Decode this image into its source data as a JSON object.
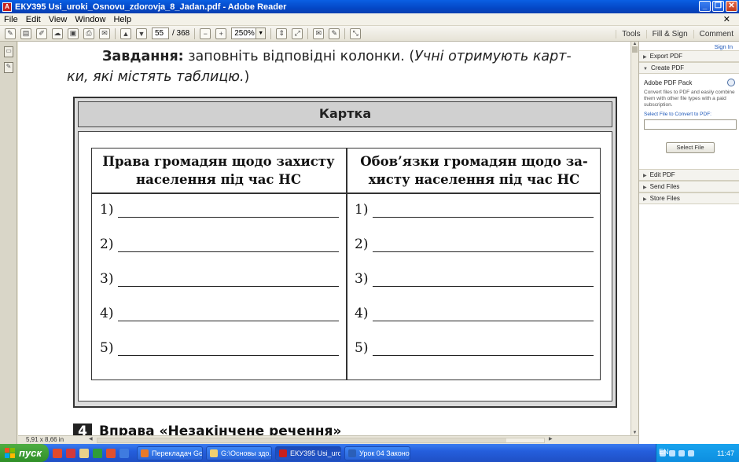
{
  "window": {
    "title": "ЕКУ395 Usi_uroki_Osnovu_zdorovja_8_Jadan.pdf - Adobe Reader"
  },
  "menu": {
    "items": [
      "File",
      "Edit",
      "View",
      "Window",
      "Help"
    ]
  },
  "toolbar": {
    "page_current": "55",
    "page_total": "/ 368",
    "zoom": "250%",
    "right_links": [
      "Tools",
      "Fill & Sign",
      "Comment"
    ]
  },
  "document": {
    "task_bold": "Завдання:",
    "task_text": " заповніть відповідні колонки. (",
    "task_italic": "Учні отримують карт-",
    "task2_italic": "ки, які містять таблицю.",
    "task2_end": ")",
    "card_title": "Картка",
    "col_left_header": "Права громадян щодо захисту населення під час НС",
    "col_right_header": "Обов’язки громадян щодо за- хисту населення під час НС",
    "rows": [
      "1)",
      "2)",
      "3)",
      "4)",
      "5)"
    ],
    "next_number": "4",
    "next_title": "Вправа «Незакінчене речення»"
  },
  "right_pane": {
    "sign_in": "Sign In",
    "export_pdf": "Export PDF",
    "create_pdf": "Create PDF",
    "pack_title": "Adobe PDF Pack",
    "pack_desc": "Convert files to PDF and easily combine them with other file types with a paid subscription.",
    "select_label": "Select File to Convert to PDF:",
    "select_button": "Select File",
    "edit_pdf": "Edit PDF",
    "send_files": "Send Files",
    "store_files": "Store Files"
  },
  "status": {
    "page_size": "5,91 x 8,66 in"
  },
  "taskbar": {
    "start": "пуск",
    "tasks": [
      "Перекладач Go...",
      "G:\\Основы здо...",
      "ЕКУ395 Usi_uro...",
      "Урок 04 Законо..."
    ],
    "lang": "EN",
    "clock": "11:47"
  }
}
